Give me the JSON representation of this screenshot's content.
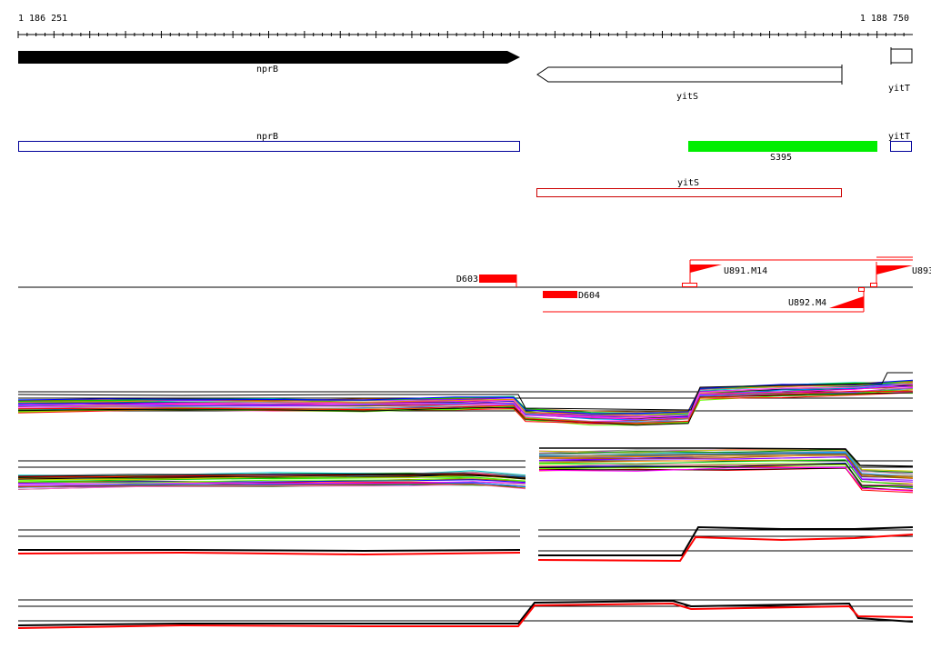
{
  "browser": {
    "coord_start": "1 186 251",
    "coord_end": "1 188 750"
  },
  "tracks": {
    "genes": [
      {
        "label": "nprB",
        "strand": "+",
        "style": "filled"
      },
      {
        "label": "yitS",
        "strand": "-",
        "style": "outline"
      },
      {
        "label": "yitT",
        "strand": "+",
        "style": "outline"
      }
    ],
    "transcripts": [
      {
        "label": "nprB"
      },
      {
        "label": "yitT"
      },
      {
        "label": "S395"
      },
      {
        "label": "yitS"
      }
    ],
    "segments": [
      {
        "label": "D603"
      },
      {
        "label": "D604"
      },
      {
        "label": "U891.M14"
      },
      {
        "label": "U892.M4"
      },
      {
        "label": "U893"
      }
    ]
  },
  "colors": {
    "gene_fill": "#000000",
    "transcript_blue": "#000099",
    "transcript_green": "#00ee00",
    "transcript_red": "#cc0000",
    "segment_red": "#ff0000"
  }
}
